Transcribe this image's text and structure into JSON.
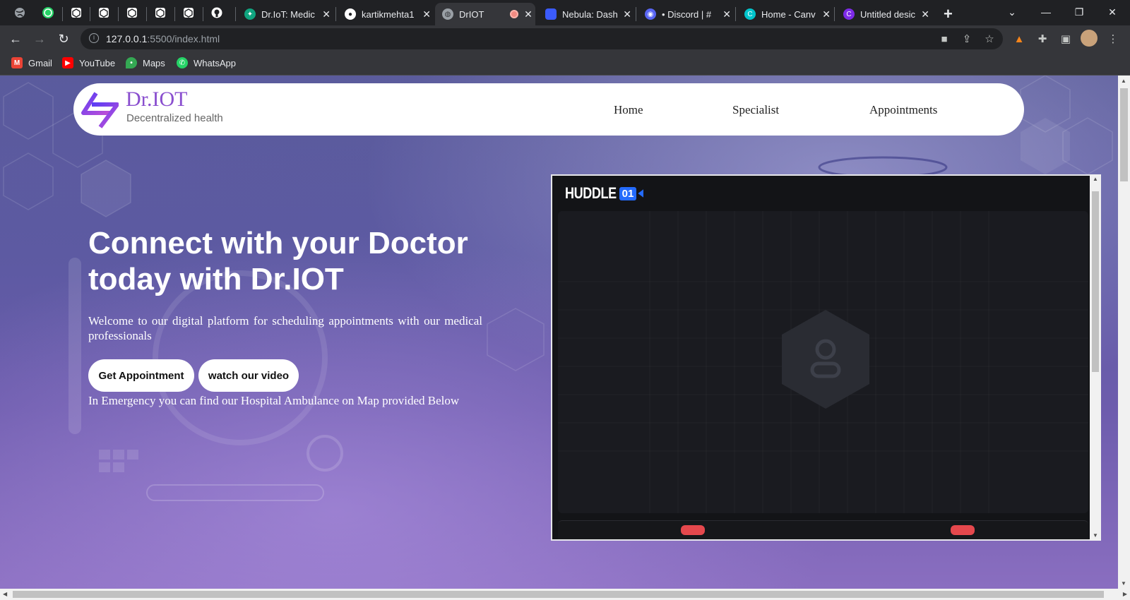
{
  "browser": {
    "tabs": [
      {
        "title": "Dr.IoT: Medic",
        "icon": "chatgpt-icon",
        "color": "#10a37f"
      },
      {
        "title": "kartikmehta1",
        "icon": "github-icon",
        "color": "#ffffff"
      },
      {
        "title": "DrIOT",
        "icon": "globe-icon",
        "color": "#9aa0a6",
        "active": true,
        "recording": true
      },
      {
        "title": "Nebula: Dash",
        "icon": "nebula-icon",
        "color": "#3b5bfd"
      },
      {
        "title": "• Discord | #",
        "icon": "discord-icon",
        "color": "#5865f2"
      },
      {
        "title": "Home - Canv",
        "icon": "canva-icon",
        "color": "#00c4cc"
      },
      {
        "title": "Untitled desic",
        "icon": "canva-icon",
        "color": "#7d2ae8"
      }
    ],
    "pinned_tabs": [
      "globe-icon",
      "whatsapp-icon",
      "codesandbox-icon",
      "codesandbox-icon",
      "codesandbox-icon",
      "codesandbox-icon",
      "codesandbox-icon",
      "github-icon"
    ],
    "new_tab_label": "+",
    "url_host": "127.0.0.1",
    "url_rest": ":5500/index.html",
    "bookmarks": [
      {
        "label": "Gmail",
        "icon": "gmail-icon",
        "color": "#ea4335"
      },
      {
        "label": "YouTube",
        "icon": "youtube-icon",
        "color": "#ff0000"
      },
      {
        "label": "Maps",
        "icon": "maps-icon",
        "color": "#34a853"
      },
      {
        "label": "WhatsApp",
        "icon": "whatsapp-icon",
        "color": "#25d366"
      }
    ]
  },
  "site": {
    "brand": "Dr.IOT",
    "tagline": "Decentralized health",
    "nav": [
      "Home",
      "Specialist",
      "Appointments"
    ],
    "hero_title": "Connect with your Doctor today with Dr.IOT",
    "hero_text": "Welcome to our digital platform for scheduling appointments with our medical professionals",
    "buttons": {
      "appointment": "Get Appointment",
      "video": "watch our video"
    },
    "emergency_text": "In Emergency you can find our Hospital Ambulance on Map provided Below",
    "accent": "#8a4fcf"
  },
  "huddle": {
    "logo_word": "HUDDLE",
    "logo_badge": "01",
    "brand_color": "#246bfd"
  }
}
